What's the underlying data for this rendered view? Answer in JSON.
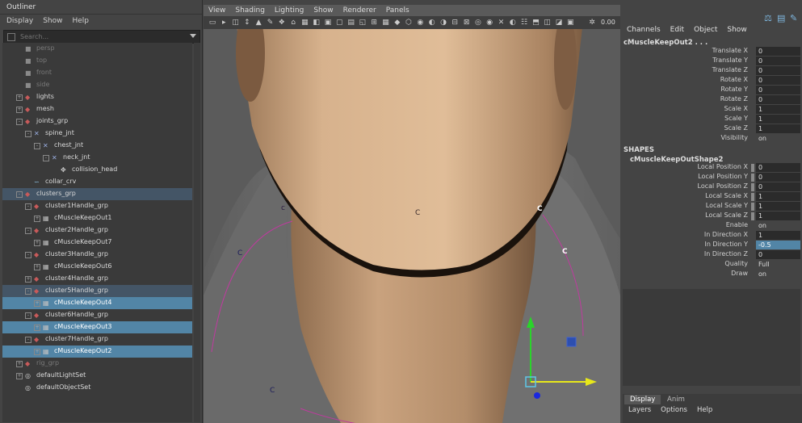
{
  "outliner": {
    "title": "Outliner",
    "menu": [
      "Display",
      "Show",
      "Help"
    ],
    "search_placeholder": "Search...",
    "items": [
      {
        "label": "persp",
        "depth": 1,
        "icon": "camera",
        "dim": true,
        "exp": ""
      },
      {
        "label": "top",
        "depth": 1,
        "icon": "camera",
        "dim": true,
        "exp": ""
      },
      {
        "label": "front",
        "depth": 1,
        "icon": "camera",
        "dim": true,
        "exp": ""
      },
      {
        "label": "side",
        "depth": 1,
        "icon": "camera",
        "dim": true,
        "exp": ""
      },
      {
        "label": "lights",
        "depth": 1,
        "icon": "group",
        "exp": "+"
      },
      {
        "label": "mesh",
        "depth": 1,
        "icon": "group",
        "exp": "+"
      },
      {
        "label": "joints_grp",
        "depth": 1,
        "icon": "group",
        "exp": "-"
      },
      {
        "label": "spine_jnt",
        "depth": 2,
        "icon": "joint",
        "exp": "-"
      },
      {
        "label": "chest_jnt",
        "depth": 3,
        "icon": "joint",
        "exp": "-"
      },
      {
        "label": "neck_jnt",
        "depth": 4,
        "icon": "joint",
        "exp": "-"
      },
      {
        "label": "collision_head",
        "depth": 5,
        "icon": "locator",
        "exp": ""
      },
      {
        "label": "collar_crv",
        "depth": 2,
        "icon": "curve",
        "exp": ""
      },
      {
        "label": "clusters_grp",
        "depth": 1,
        "icon": "group",
        "exp": "-",
        "grp": true
      },
      {
        "label": "cluster1Handle_grp",
        "depth": 2,
        "icon": "group",
        "exp": "-"
      },
      {
        "label": "cMuscleKeepOut1",
        "depth": 3,
        "icon": "muscle",
        "exp": "+"
      },
      {
        "label": "cluster2Handle_grp",
        "depth": 2,
        "icon": "group",
        "exp": "-"
      },
      {
        "label": "cMuscleKeepOut7",
        "depth": 3,
        "icon": "muscle",
        "exp": "+"
      },
      {
        "label": "cluster3Handle_grp",
        "depth": 2,
        "icon": "group",
        "exp": "-"
      },
      {
        "label": "cMuscleKeepOut6",
        "depth": 3,
        "icon": "muscle",
        "exp": "+"
      },
      {
        "label": "cluster4Handle_grp",
        "depth": 2,
        "icon": "group",
        "exp": "+"
      },
      {
        "label": "cluster5Handle_grp",
        "depth": 2,
        "icon": "group",
        "exp": "-",
        "grp": true
      },
      {
        "label": "cMuscleKeepOut4",
        "depth": 3,
        "icon": "muscle",
        "exp": "+",
        "sel": true
      },
      {
        "label": "cluster6Handle_grp",
        "depth": 2,
        "icon": "group",
        "exp": "-"
      },
      {
        "label": "cMuscleKeepOut3",
        "depth": 3,
        "icon": "muscle",
        "exp": "+",
        "sel": true
      },
      {
        "label": "cluster7Handle_grp",
        "depth": 2,
        "icon": "group",
        "exp": "-"
      },
      {
        "label": "cMuscleKeepOut2",
        "depth": 3,
        "icon": "muscle",
        "exp": "+",
        "sel": true
      },
      {
        "label": "rig_grp",
        "depth": 1,
        "icon": "group",
        "dim": true,
        "exp": "+"
      },
      {
        "label": "defaultLightSet",
        "depth": 1,
        "icon": "set",
        "exp": "+"
      },
      {
        "label": "defaultObjectSet",
        "depth": 1,
        "icon": "set",
        "exp": ""
      }
    ]
  },
  "viewport": {
    "menu": [
      "View",
      "Shading",
      "Lighting",
      "Show",
      "Renderer",
      "Panels"
    ],
    "toolbar_value": "0.00",
    "labels": [
      "c",
      "C",
      "C",
      "C",
      "C",
      "C"
    ]
  },
  "channel_box": {
    "menu": [
      "Channels",
      "Edit",
      "Object",
      "Show"
    ],
    "node_name": "cMuscleKeepOut2 . . .",
    "transform": [
      {
        "name": "Translate X",
        "value": "0"
      },
      {
        "name": "Translate Y",
        "value": "0"
      },
      {
        "name": "Translate Z",
        "value": "0"
      },
      {
        "name": "Rotate X",
        "value": "0"
      },
      {
        "name": "Rotate Y",
        "value": "0"
      },
      {
        "name": "Rotate Z",
        "value": "0"
      },
      {
        "name": "Scale X",
        "value": "1"
      },
      {
        "name": "Scale Y",
        "value": "1"
      },
      {
        "name": "Scale Z",
        "value": "1"
      },
      {
        "name": "Visibility",
        "value": "on"
      }
    ],
    "shapes_header": "SHAPES",
    "shape_name": "cMuscleKeepOutShape2",
    "shape_attrs": [
      {
        "name": "Local Position X",
        "value": "0"
      },
      {
        "name": "Local Position Y",
        "value": "0"
      },
      {
        "name": "Local Position Z",
        "value": "0"
      },
      {
        "name": "Local Scale X",
        "value": "1"
      },
      {
        "name": "Local Scale Y",
        "value": "1"
      },
      {
        "name": "Local Scale Z",
        "value": "1"
      },
      {
        "name": "Enable",
        "value": "on"
      },
      {
        "name": "In Direction X",
        "value": "1"
      },
      {
        "name": "In Direction Y",
        "value": "-0.5"
      },
      {
        "name": "In Direction Z",
        "value": "0"
      },
      {
        "name": "Quality",
        "value": "Full"
      },
      {
        "name": "Draw",
        "value": "on"
      }
    ],
    "tabs": [
      "Display",
      "Anim"
    ],
    "bottom_menu": [
      "Layers",
      "Options",
      "Help"
    ]
  },
  "colors": {
    "selection": "#5285a6",
    "skin": "#d6b08a",
    "shirt": "#6e6e6e"
  }
}
